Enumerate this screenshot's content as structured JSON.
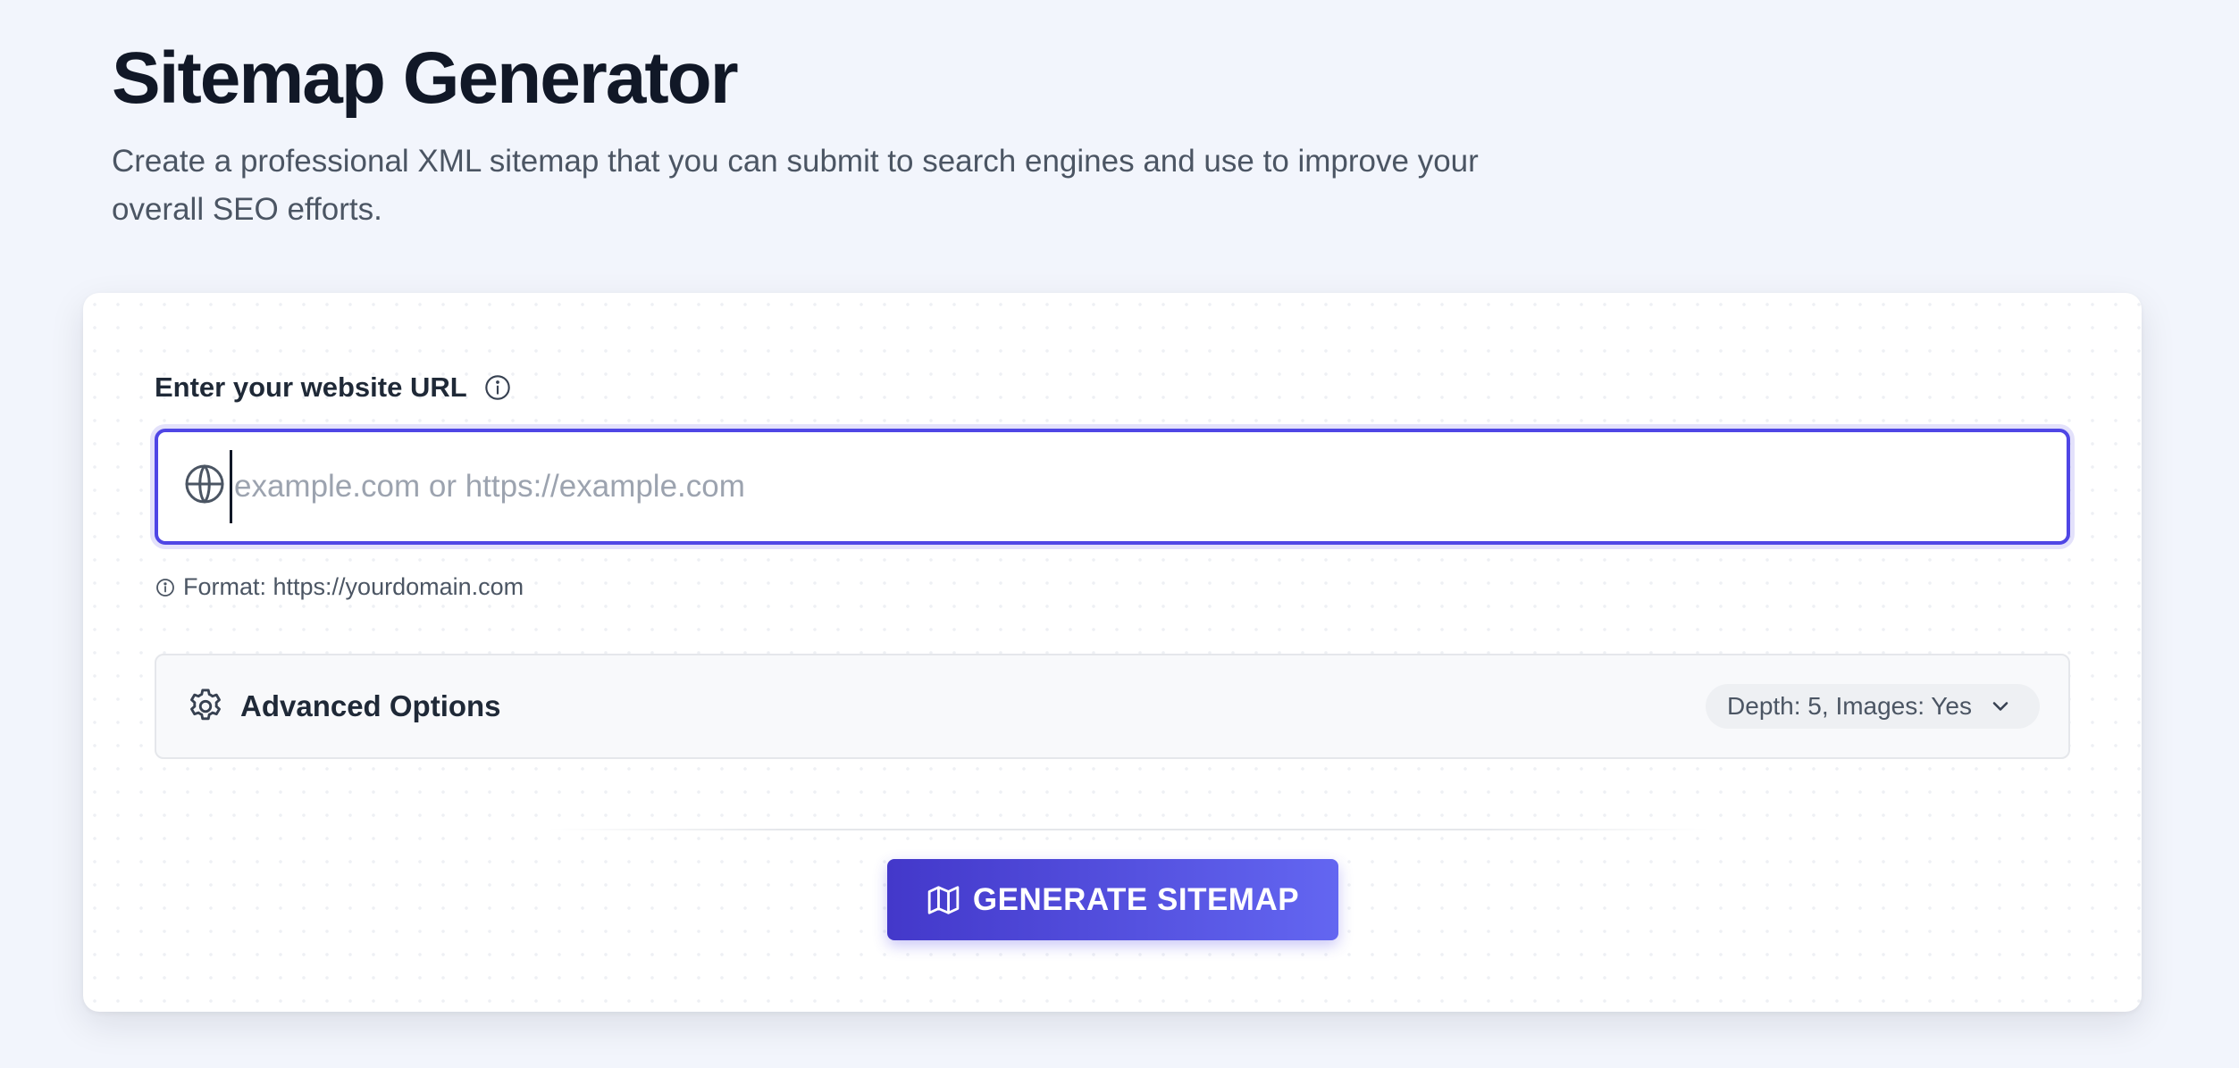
{
  "page": {
    "title": "Sitemap Generator",
    "subtitle": "Create a professional XML sitemap that you can submit to search engines and use to improve your overall SEO efforts."
  },
  "form": {
    "url_label": "Enter your website URL",
    "url_label_icon": "info-icon",
    "url_input_icon": "globe-icon",
    "url_placeholder": "example.com or https://example.com",
    "url_value": "",
    "format_hint_icon": "info-icon",
    "format_hint": "Format: https://yourdomain.com"
  },
  "advanced": {
    "icon": "gear-icon",
    "title": "Advanced Options",
    "summary": "Depth: 5, Images: Yes",
    "toggle_icon": "chevron-down-icon"
  },
  "action": {
    "icon": "map-icon",
    "generate_label": "GENERATE SITEMAP"
  },
  "colors": {
    "accent": "#4f46e5",
    "accent_light": "#6366f1",
    "page_background": "#f2f5fc",
    "card_background": "#ffffff",
    "heading_text": "#111827",
    "body_text": "#4b5563",
    "placeholder_text": "#9ca3af"
  }
}
